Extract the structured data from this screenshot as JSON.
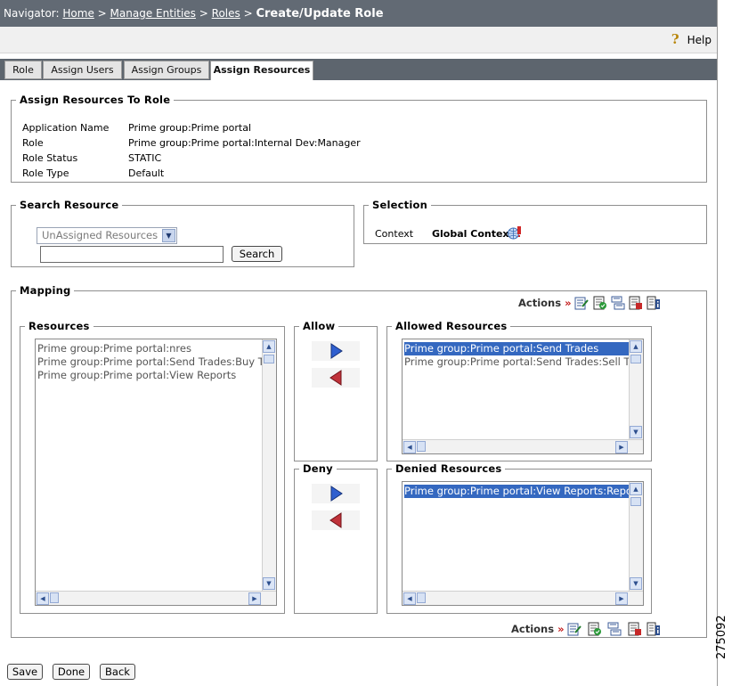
{
  "navigator": {
    "prefix": "Navigator:",
    "crumbs": [
      "Home",
      "Manage Entities",
      "Roles"
    ],
    "sep": ">",
    "current": "Create/Update Role"
  },
  "help": {
    "label": "Help"
  },
  "tabs": [
    {
      "label": "Role",
      "active": false
    },
    {
      "label": "Assign Users",
      "active": false
    },
    {
      "label": "Assign Groups",
      "active": false
    },
    {
      "label": "Assign Resources",
      "active": true
    }
  ],
  "assign_section": {
    "title": "Assign Resources To Role",
    "fields": [
      {
        "label": "Application Name",
        "value": "Prime group:Prime portal"
      },
      {
        "label": "Role",
        "value": "Prime group:Prime portal:Internal Dev:Manager"
      },
      {
        "label": "Role Status",
        "value": "STATIC"
      },
      {
        "label": "Role Type",
        "value": "Default"
      }
    ]
  },
  "search_resource": {
    "title": "Search Resource",
    "dropdown_selected": "UnAssigned Resources",
    "input_value": "",
    "search_button": "Search"
  },
  "selection": {
    "title": "Selection",
    "context_label": "Context",
    "context_value": "Global Context"
  },
  "mapping": {
    "title": "Mapping",
    "actions_label": "Actions",
    "actions_arrow": "»",
    "resources": {
      "title": "Resources",
      "items": [
        "Prime group:Prime portal:nres",
        "Prime group:Prime portal:Send Trades:Buy Tr",
        "Prime group:Prime portal:View Reports"
      ]
    },
    "allow": {
      "title": "Allow"
    },
    "deny": {
      "title": "Deny"
    },
    "allowed_resources": {
      "title": "Allowed Resources",
      "items": [
        {
          "text": "Prime group:Prime portal:Send Trades",
          "selected": true
        },
        {
          "text": "Prime group:Prime portal:Send Trades:Sell Tr",
          "selected": false
        }
      ]
    },
    "denied_resources": {
      "title": "Denied Resources",
      "items": [
        {
          "text": "Prime group:Prime portal:View Reports:Repor",
          "selected": true
        }
      ]
    }
  },
  "footer_buttons": {
    "save": "Save",
    "done": "Done",
    "back": "Back"
  },
  "figure_number": "275092",
  "colors": {
    "nav_bg": "#626a74",
    "tab_bar_bg": "#5d656e",
    "selection_blue": "#3468c0",
    "arrow_blue": "#2f5fcf",
    "arrow_red": "#c0323a"
  }
}
